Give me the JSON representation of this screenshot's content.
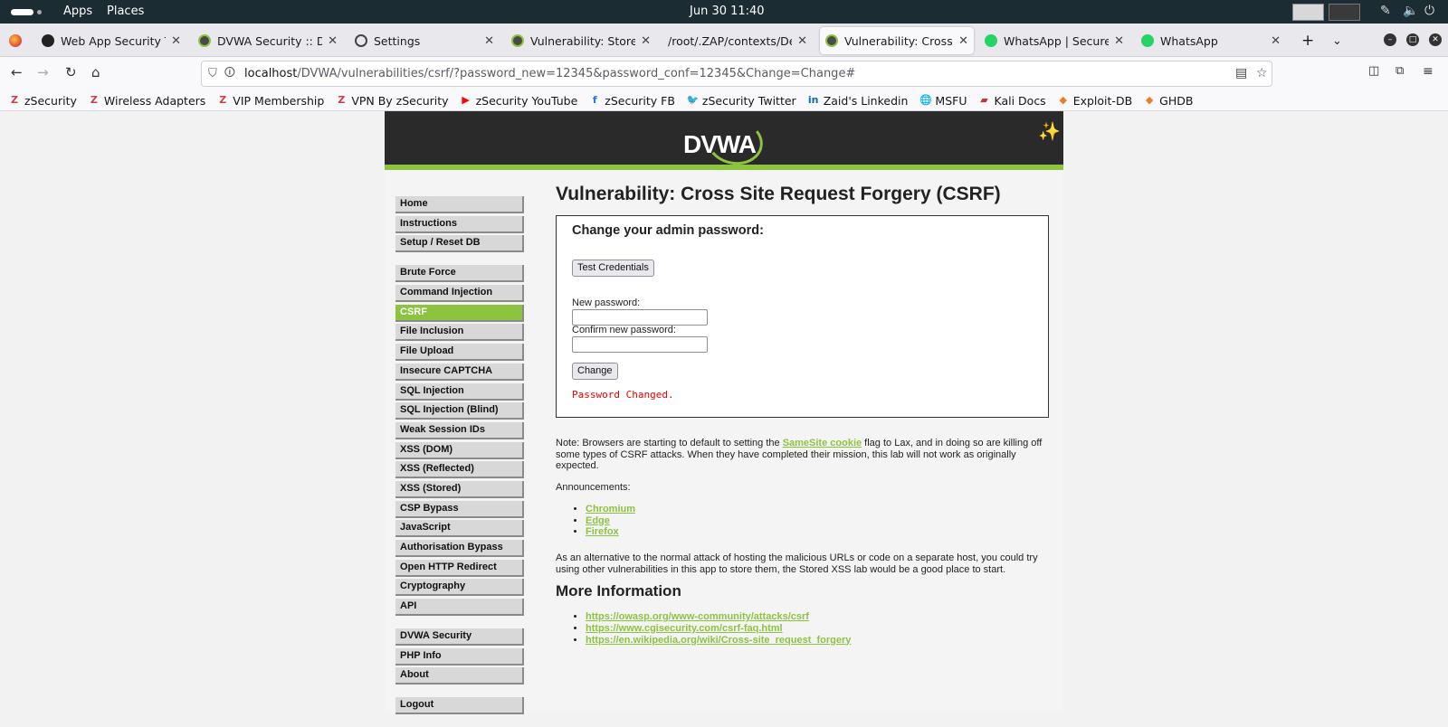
{
  "topbar": {
    "apps": "Apps",
    "places": "Places",
    "clock": "Jun 30  11:40"
  },
  "tabs": [
    {
      "label": "Web App Security Testi",
      "icon": "github-icon"
    },
    {
      "label": "DVWA Security :: Damn",
      "icon": "dvwa-icon"
    },
    {
      "label": "Settings",
      "icon": "gear-icon"
    },
    {
      "label": "Vulnerability: Stored Cr",
      "icon": "dvwa-icon"
    },
    {
      "label": "/root/.ZAP/contexts/Defau",
      "icon": "file-icon"
    },
    {
      "label": "Vulnerability: Cross Site",
      "icon": "dvwa-icon"
    },
    {
      "label": "WhatsApp | Secure and",
      "icon": "whatsapp-icon"
    },
    {
      "label": "WhatsApp",
      "icon": "whatsapp-icon"
    }
  ],
  "urlbar": {
    "host": "localhost",
    "path": "/DVWA/vulnerabilities/csrf/?password_new=12345&password_conf=12345&Change=Change#"
  },
  "bookmarks": [
    {
      "label": "zSecurity",
      "icon": "z-icon",
      "color": "#d04040"
    },
    {
      "label": "Wireless Adapters",
      "icon": "z-icon",
      "color": "#d04040"
    },
    {
      "label": "VIP Membership",
      "icon": "z-icon",
      "color": "#d04040"
    },
    {
      "label": "VPN By zSecurity",
      "icon": "z-icon",
      "color": "#d04040"
    },
    {
      "label": "zSecurity YouTube",
      "icon": "youtube-icon",
      "color": "#ff0000"
    },
    {
      "label": "zSecurity FB",
      "icon": "facebook-icon",
      "color": "#1877f2"
    },
    {
      "label": "zSecurity Twitter",
      "icon": "twitter-icon",
      "color": "#1da1f2"
    },
    {
      "label": "Zaid's Linkedin",
      "icon": "linkedin-icon",
      "color": "#0a66c2"
    },
    {
      "label": "MSFU",
      "icon": "globe-icon",
      "color": "#555555"
    },
    {
      "label": "Kali Docs",
      "icon": "kali-icon",
      "color": "#c0392b"
    },
    {
      "label": "Exploit-DB",
      "icon": "exploitdb-icon",
      "color": "#e67e22"
    },
    {
      "label": "GHDB",
      "icon": "ghdb-icon",
      "color": "#e67e22"
    }
  ],
  "header": {
    "logo_text": "DVWA"
  },
  "menu": {
    "group1": [
      "Home",
      "Instructions",
      "Setup / Reset DB"
    ],
    "group2": [
      "Brute Force",
      "Command Injection",
      "CSRF",
      "File Inclusion",
      "File Upload",
      "Insecure CAPTCHA",
      "SQL Injection",
      "SQL Injection (Blind)",
      "Weak Session IDs",
      "XSS (DOM)",
      "XSS (Reflected)",
      "XSS (Stored)",
      "CSP Bypass",
      "JavaScript",
      "Authorisation Bypass",
      "Open HTTP Redirect",
      "Cryptography",
      "API"
    ],
    "group3": [
      "DVWA Security",
      "PHP Info",
      "About"
    ],
    "group4": [
      "Logout"
    ],
    "selected": "CSRF"
  },
  "main": {
    "title": "Vulnerability: Cross Site Request Forgery (CSRF)",
    "box_title": "Change your admin password:",
    "test_button": "Test Credentials",
    "new_password_label": "New password:",
    "confirm_password_label": "Confirm new password:",
    "change_button": "Change",
    "message": "Password Changed.",
    "note_before": "Note: Browsers are starting to default to setting the ",
    "note_link": "SameSite cookie",
    "note_after": " flag to Lax, and in doing so are killing off some types of CSRF attacks. When they have completed their mission, this lab will not work as originally expected.",
    "announcements_label": "Announcements:",
    "announcements": [
      "Chromium",
      "Edge",
      "Firefox"
    ],
    "alternative_text": "As an alternative to the normal attack of hosting the malicious URLs or code on a separate host, you could try using other vulnerabilities in this app to store them, the Stored XSS lab would be a good place to start.",
    "more_info_title": "More Information",
    "more_info_links": [
      "https://owasp.org/www-community/attacks/csrf",
      "https://www.cgisecurity.com/csrf-faq.html",
      "https://en.wikipedia.org/wiki/Cross-site_request_forgery"
    ]
  }
}
